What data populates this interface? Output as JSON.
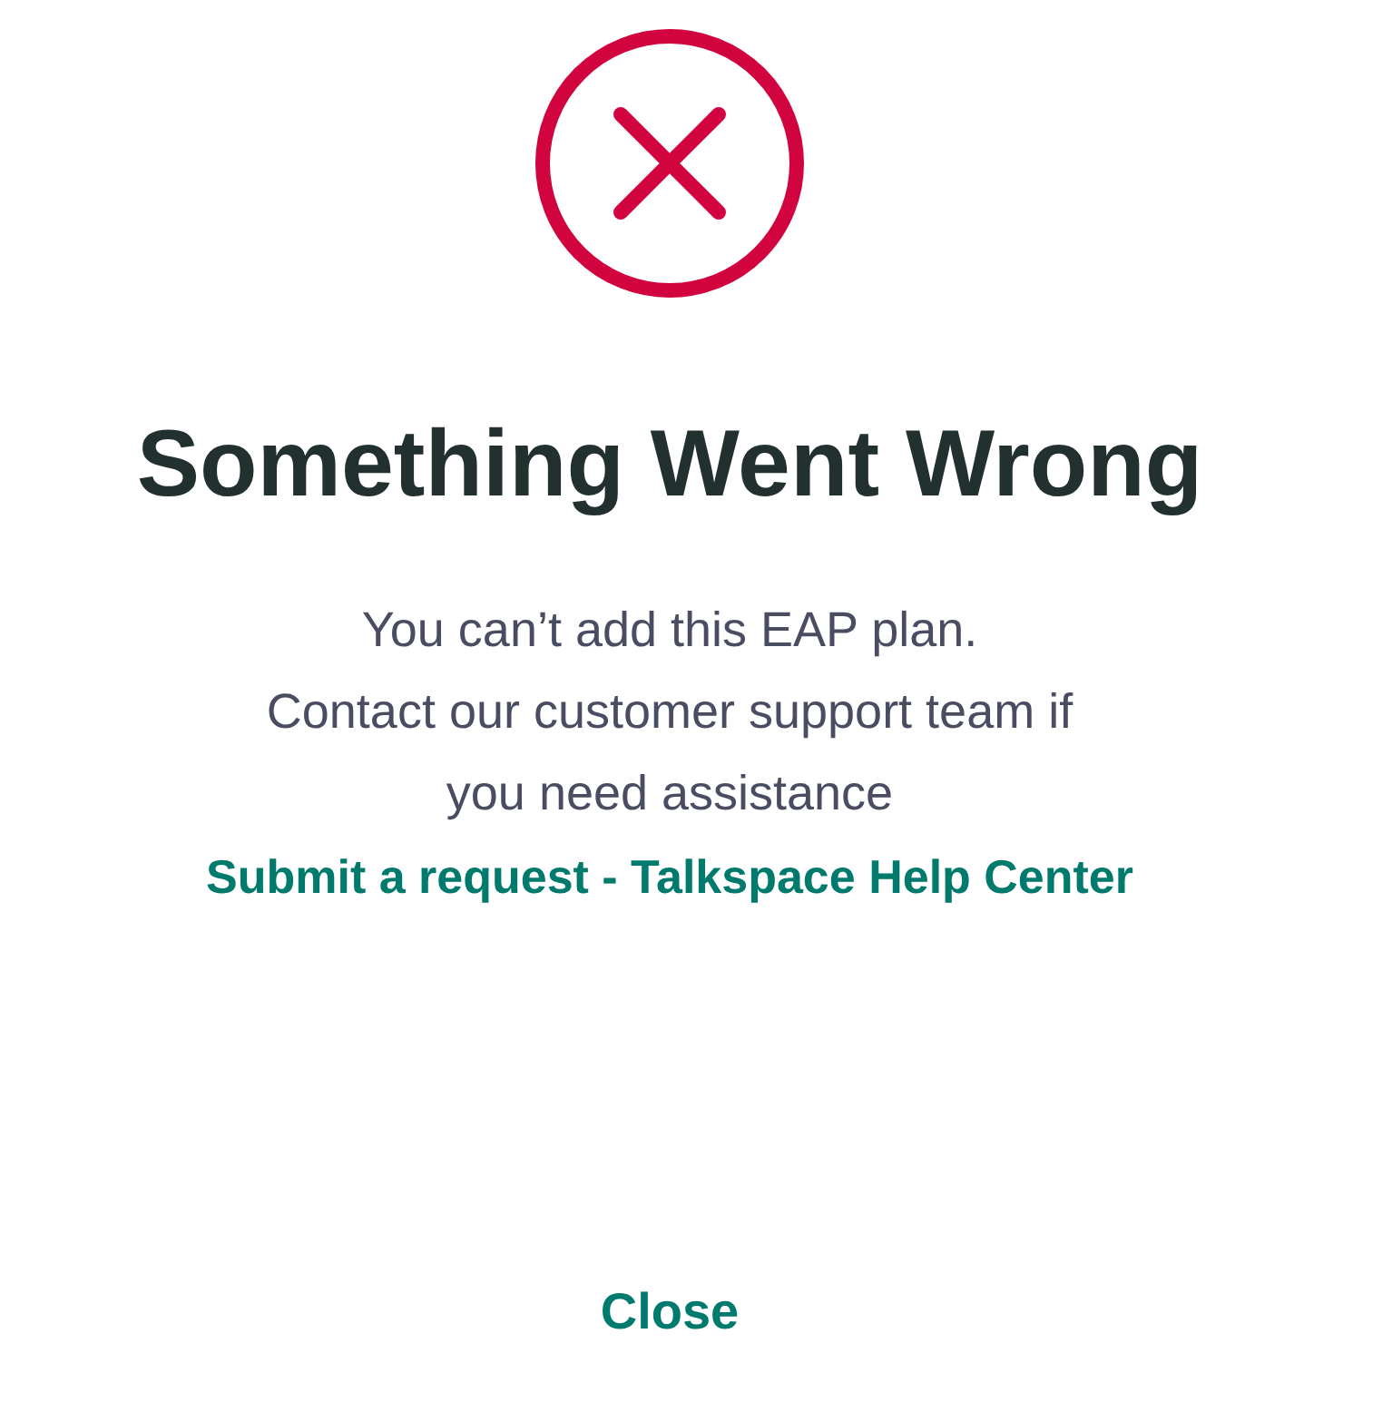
{
  "title": "Something Went Wrong",
  "message_lines": [
    "You can’t add this EAP plan.",
    "Contact our customer support team if",
    "you need assistance"
  ],
  "help_link": "Submit a request - Talkspace Help Center",
  "close_button": "Close"
}
